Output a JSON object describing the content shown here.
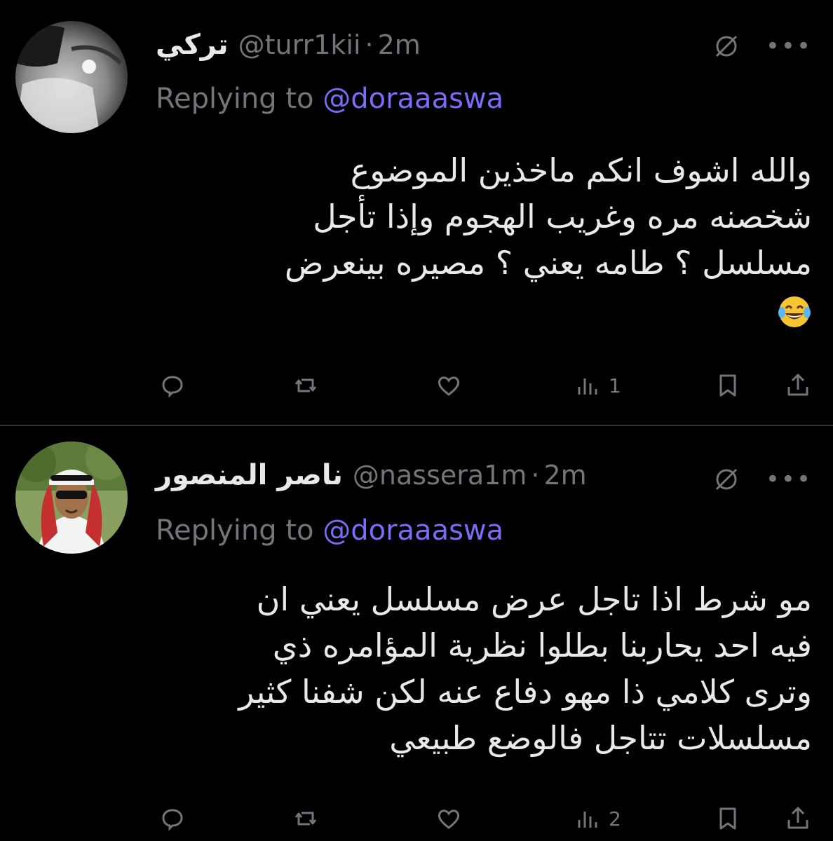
{
  "tweets": [
    {
      "name": "تركي",
      "handle": "@turr1kii",
      "separator": "·",
      "time": "2m",
      "replying_prefix": "Replying to ",
      "replying_to": "@doraaaswa",
      "lines": [
        "والله اشوف انكم ماخذين الموضوع",
        "شخصنه مره وغريب الهجوم وإذا تأجل",
        "مسلسل ؟ طامه يعني ؟ مصيره بينعرض"
      ],
      "emoji": "face-with-tears-of-joy",
      "views": "1"
    },
    {
      "name": "ناصر المنصور",
      "handle": "@nassera1m",
      "separator": "·",
      "time": "2m",
      "replying_prefix": "Replying to ",
      "replying_to": "@doraaaswa",
      "lines": [
        "مو شرط اذا تاجل عرض مسلسل يعني ان",
        "فيه احد يحاربنا بطلوا نظرية المؤامره ذي",
        "وترى كلامي ذا مهو دفاع عنه لكن شفنا كثير",
        "مسلسلات تتاجل فالوضع طبيعي"
      ],
      "views": "2"
    }
  ],
  "colors": {
    "background": "#000000",
    "text": "#e7e9ea",
    "muted": "#71767b",
    "mention": "#7b6cf6",
    "divider": "#2f3336"
  },
  "icons": [
    "grok-icon",
    "more-icon",
    "reply-icon",
    "retweet-icon",
    "like-icon",
    "views-icon",
    "bookmark-icon",
    "share-icon"
  ]
}
